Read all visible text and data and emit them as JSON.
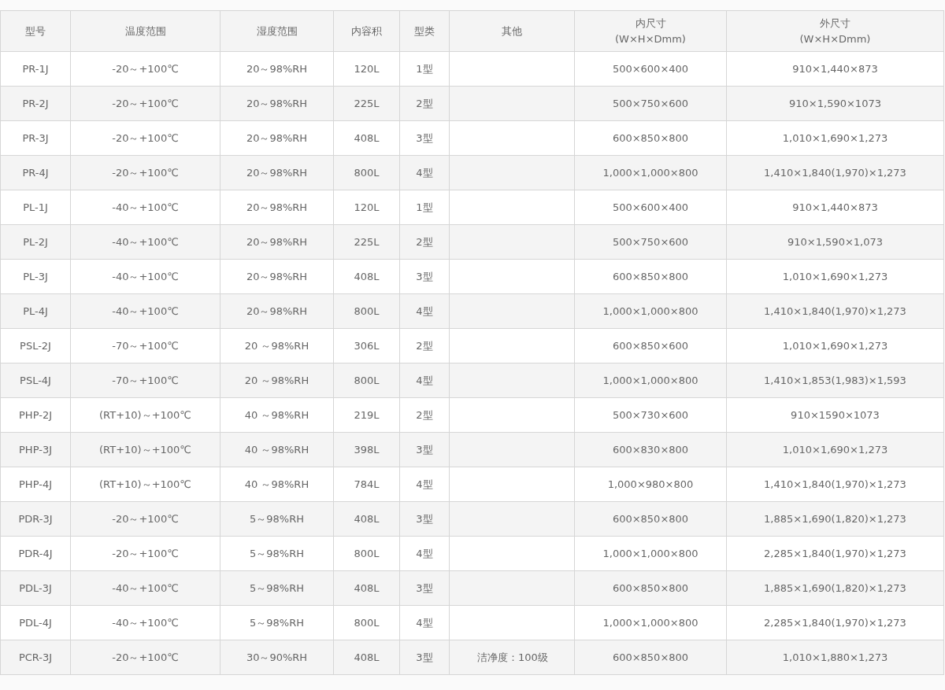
{
  "table": {
    "columns": [
      "型号",
      "温度范围",
      "湿度范围",
      "内容积",
      "型类",
      "其他",
      "内尺寸\n(W×H×Dmm)",
      "外尺寸\n(W×H×Dmm)"
    ],
    "rows": [
      {
        "model": "PR-1J",
        "temp_range": "-20～+100℃",
        "humidity_range": "20～98%RH",
        "capacity": "120L",
        "type": "1型",
        "inner_size": "500×600×400",
        "outer_size": "910×1,440×873"
      },
      {
        "model": "PR-2J",
        "temp_range": "-20～+100℃",
        "humidity_range": "20～98%RH",
        "capacity": "225L",
        "type": "2型",
        "inner_size": "500×750×600",
        "outer_size": "910×1,590×1073"
      },
      {
        "model": "PR-3J",
        "temp_range": "-20～+100℃",
        "humidity_range": "20～98%RH",
        "capacity": "408L",
        "type": "3型",
        "inner_size": "600×850×800",
        "outer_size": "1,010×1,690×1,273"
      },
      {
        "model": "PR-4J",
        "temp_range": "-20～+100℃",
        "humidity_range": "20～98%RH",
        "capacity": "800L",
        "type": "4型",
        "inner_size": "1,000×1,000×800",
        "outer_size": "1,410×1,840(1,970)×1,273"
      },
      {
        "model": "PL-1J",
        "temp_range": "-40～+100℃",
        "humidity_range": "20～98%RH",
        "capacity": "120L",
        "type": "1型",
        "inner_size": "500×600×400",
        "outer_size": "910×1,440×873"
      },
      {
        "model": "PL-2J",
        "temp_range": "-40～+100℃",
        "humidity_range": "20～98%RH",
        "capacity": "225L",
        "type": "2型",
        "inner_size": "500×750×600",
        "outer_size": "910×1,590×1,073"
      },
      {
        "model": "PL-3J",
        "temp_range": "-40～+100℃",
        "humidity_range": "20～98%RH",
        "capacity": "408L",
        "type": "3型",
        "inner_size": "600×850×800",
        "outer_size": "1,010×1,690×1,273"
      },
      {
        "model": "PL-4J",
        "temp_range": "-40～+100℃",
        "humidity_range": "20～98%RH",
        "capacity": "800L",
        "type": "4型",
        "inner_size": "1,000×1,000×800",
        "outer_size": "1,410×1,840(1,970)×1,273"
      },
      {
        "model": "PSL-2J",
        "temp_range": "-70～+100℃",
        "humidity_range": "20 ～98%RH",
        "capacity": "306L",
        "type": "2型",
        "inner_size": "600×850×600",
        "outer_size": "1,010×1,690×1,273"
      },
      {
        "model": "PSL-4J",
        "temp_range": "-70～+100℃",
        "humidity_range": "20 ～98%RH",
        "capacity": "800L",
        "type": "4型",
        "inner_size": "1,000×1,000×800",
        "outer_size": "1,410×1,853(1,983)×1,593"
      },
      {
        "model": "PHP-2J",
        "temp_range": "(RT+10)～+100℃",
        "humidity_range": "40 ～98%RH",
        "capacity": "219L",
        "type": "2型",
        "inner_size": "500×730×600",
        "outer_size": "910×1590×1073"
      },
      {
        "model": "PHP-3J",
        "temp_range": "(RT+10)～+100℃",
        "humidity_range": "40 ～98%RH",
        "capacity": "398L",
        "type": "3型",
        "inner_size": "600×830×800",
        "outer_size": "1,010×1,690×1,273"
      },
      {
        "model": "PHP-4J",
        "temp_range": "(RT+10)～+100℃",
        "humidity_range": "40 ～98%RH",
        "capacity": "784L",
        "type": "4型",
        "inner_size": "1,000×980×800",
        "outer_size": "1,410×1,840(1,970)×1,273"
      },
      {
        "model": "PDR-3J",
        "temp_range": "-20～+100℃",
        "humidity_range": "5～98%RH",
        "capacity": "408L",
        "type": "3型",
        "inner_size": "600×850×800",
        "outer_size": "1,885×1,690(1,820)×1,273"
      },
      {
        "model": "PDR-4J",
        "temp_range": "-20～+100℃",
        "humidity_range": "5～98%RH",
        "capacity": "800L",
        "type": "4型",
        "inner_size": "1,000×1,000×800",
        "outer_size": "2,285×1,840(1,970)×1,273"
      },
      {
        "model": "PDL-3J",
        "temp_range": "-40～+100℃",
        "humidity_range": "5～98%RH",
        "capacity": "408L",
        "type": "3型",
        "inner_size": "600×850×800",
        "outer_size": "1,885×1,690(1,820)×1,273"
      },
      {
        "model": "PDL-4J",
        "temp_range": "-40～+100℃",
        "humidity_range": "5～98%RH",
        "capacity": "800L",
        "type": "4型",
        "inner_size": "1,000×1,000×800",
        "outer_size": "2,285×1,840(1,970)×1,273"
      },
      {
        "model": "PCR-3J",
        "temp_range": "-20～+100℃",
        "humidity_range": "30～90%RH",
        "capacity": "408L",
        "type": "3型",
        "other": "洁净度：100级",
        "inner_size": "600×850×800",
        "outer_size": "1,010×1,880×1,273"
      }
    ]
  }
}
